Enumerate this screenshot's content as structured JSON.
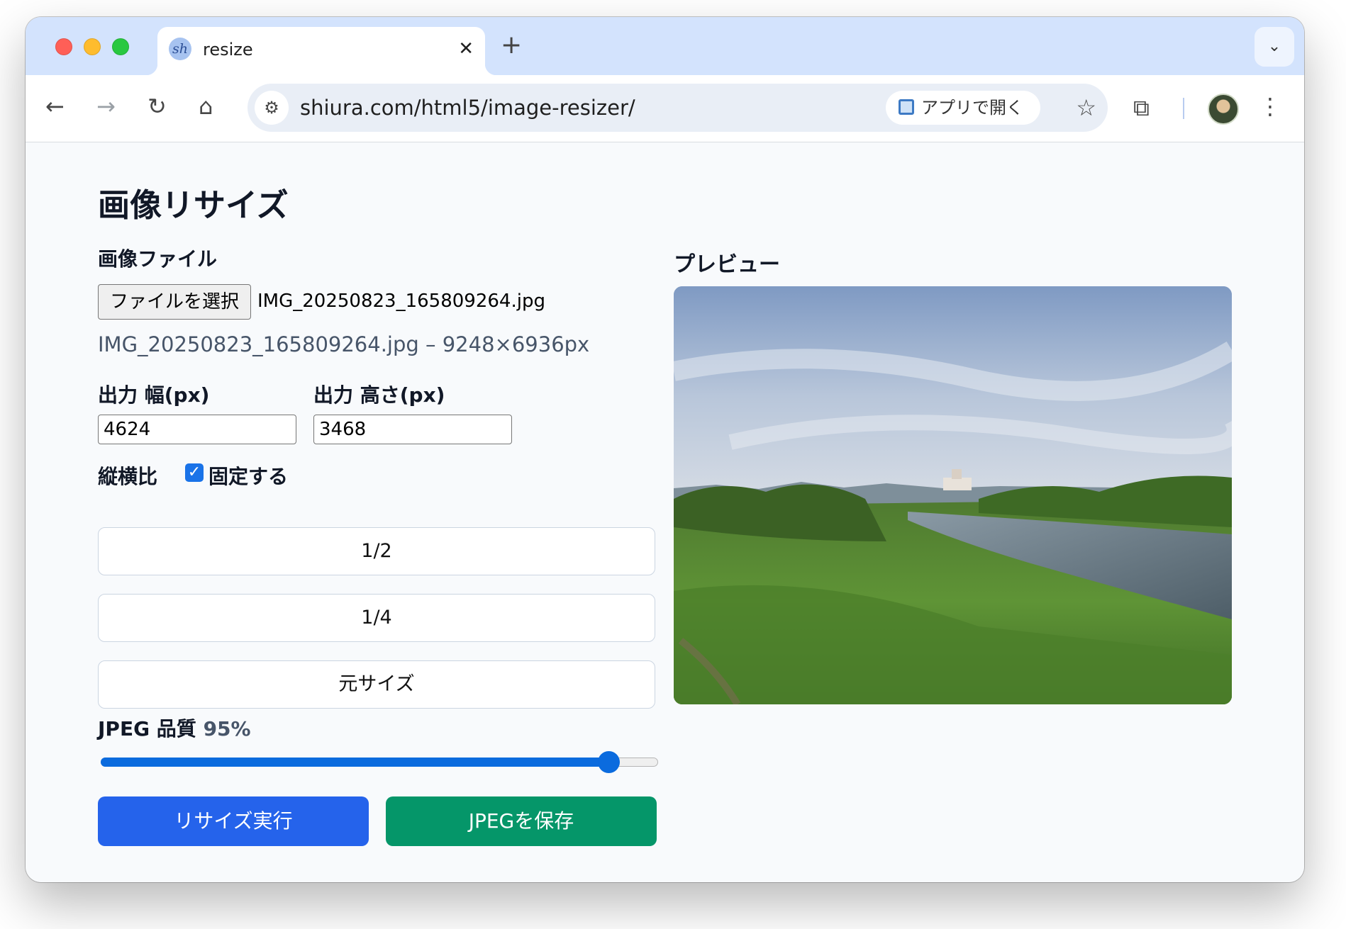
{
  "browser": {
    "tab_title": "resize",
    "favicon_text": "sh",
    "url": "shiura.com/html5/image-resizer/",
    "open_app_label": "アプリで開く",
    "icons": [
      "back-arrow-icon",
      "forward-arrow-icon",
      "reload-icon",
      "home-icon",
      "site-info-icon",
      "star-icon",
      "extensions-icon",
      "kebab-menu-icon",
      "close-icon",
      "plus-icon",
      "chevron-down-icon"
    ]
  },
  "page": {
    "title": "画像リサイズ",
    "file_section_label": "画像ファイル",
    "file_button_label": "ファイルを選択",
    "selected_file_name": "IMG_20250823_165809264.jpg",
    "file_info": "IMG_20250823_165809264.jpg – 9248×6936px",
    "width_label": "出力 幅(px)",
    "width_value": "4624",
    "height_label": "出力 高さ(px)",
    "height_value": "3468",
    "aspect_label": "縦横比",
    "aspect_lock_label": "固定する",
    "aspect_locked": true,
    "presets": [
      {
        "label": "1/2"
      },
      {
        "label": "1/4"
      },
      {
        "label": "元サイズ"
      }
    ],
    "quality_label": "JPEG 品質",
    "quality_value_text": "95%",
    "quality_value": 95,
    "resize_button_label": "リサイズ実行",
    "save_button_label": "JPEGを保存",
    "preview_label": "プレビュー"
  },
  "colors": {
    "tabbar": "#d3e3fd",
    "primary_button": "#2563eb",
    "save_button": "#059669",
    "slider": "#0b6bde"
  }
}
